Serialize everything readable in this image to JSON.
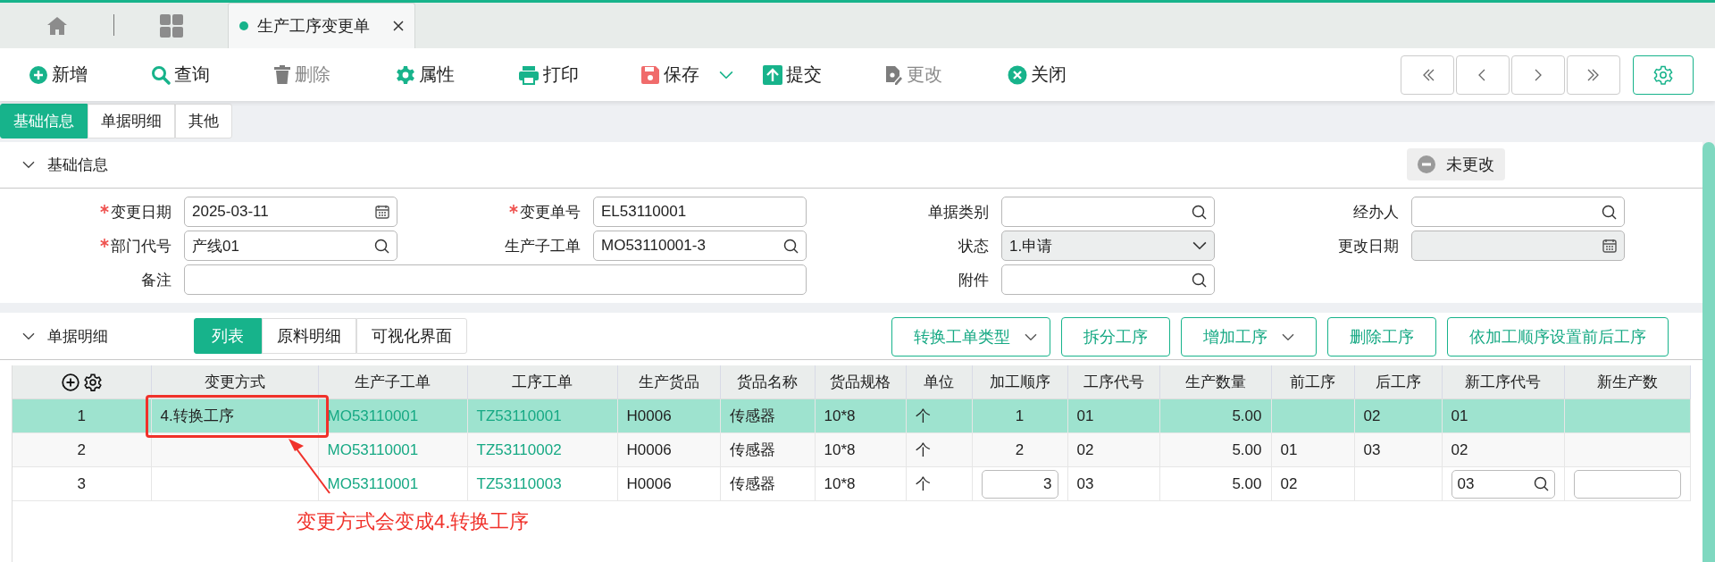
{
  "tabs": [
    {
      "label": "生产工序变更单",
      "selected": true
    }
  ],
  "toolbar": [
    {
      "kind": "add",
      "label": "新增",
      "disabled": false
    },
    {
      "kind": "query",
      "label": "查询",
      "disabled": false
    },
    {
      "kind": "delete",
      "label": "删除",
      "disabled": true
    },
    {
      "kind": "properties",
      "label": "属性",
      "disabled": false
    },
    {
      "kind": "print",
      "label": "打印",
      "disabled": false
    },
    {
      "kind": "save",
      "label": "保存",
      "disabled": false,
      "dropdown": true
    },
    {
      "kind": "submit",
      "label": "提交",
      "disabled": false
    },
    {
      "kind": "modify",
      "label": "更改",
      "disabled": true
    },
    {
      "kind": "close",
      "label": "关闭",
      "disabled": false
    }
  ],
  "page_tabs": [
    {
      "label": "基础信息",
      "selected": true
    },
    {
      "label": "单据明细",
      "selected": false
    },
    {
      "label": "其他",
      "selected": false
    }
  ],
  "basic_section": {
    "title": "基础信息",
    "expanded": true,
    "status_badge": "未更改",
    "rows": [
      [
        {
          "label": "变更日期",
          "required": true,
          "value": "2025-03-11",
          "kind": "date"
        },
        {
          "label": "变更单号",
          "required": true,
          "value": "EL53110001",
          "kind": "text"
        },
        {
          "label": "单据类别",
          "required": false,
          "kind": "lookup"
        },
        {
          "label": "经办人",
          "required": false,
          "kind": "lookup"
        }
      ],
      [
        {
          "label": "部门代号",
          "required": true,
          "value": "产线01",
          "kind": "lookup"
        },
        {
          "label": "生产子工单",
          "required": false,
          "value": "MO53110001-3",
          "kind": "lookup"
        },
        {
          "label": "状态",
          "required": false,
          "value": "1.申请",
          "kind": "select"
        },
        {
          "label": "更改日期",
          "required": false,
          "kind": "date",
          "disabled": true
        }
      ],
      [
        {
          "label": "备注",
          "required": false,
          "kind": "text",
          "wide": true
        },
        null,
        {
          "label": "附件",
          "required": false,
          "kind": "lookup"
        }
      ]
    ]
  },
  "detail_section": {
    "title": "单据明细",
    "expanded": true,
    "sub_tabs": [
      {
        "label": "列表",
        "selected": true
      },
      {
        "label": "原料明细",
        "selected": false
      },
      {
        "label": "可视化界面",
        "selected": false
      }
    ],
    "actions": [
      {
        "label": "转换工单类型",
        "dropdown": true
      },
      {
        "label": "拆分工序",
        "dropdown": false
      },
      {
        "label": "增加工序",
        "dropdown": true
      },
      {
        "label": "删除工序",
        "dropdown": false
      },
      {
        "label": "依加工顺序设置前后工序",
        "dropdown": false
      }
    ]
  },
  "table": {
    "columns": [
      {
        "kind": "index"
      },
      {
        "label": "变更方式",
        "kind": "text"
      },
      {
        "label": "生产子工单",
        "kind": "link"
      },
      {
        "label": "工序工单",
        "kind": "link"
      },
      {
        "label": "生产货品",
        "kind": "text"
      },
      {
        "label": "货品名称",
        "kind": "text"
      },
      {
        "label": "货品规格",
        "kind": "text"
      },
      {
        "label": "单位",
        "kind": "text"
      },
      {
        "label": "加工顺序",
        "kind": "order"
      },
      {
        "label": "工序代号",
        "kind": "text"
      },
      {
        "label": "生产数量",
        "kind": "number"
      },
      {
        "label": "前工序",
        "kind": "text"
      },
      {
        "label": "后工序",
        "kind": "text"
      },
      {
        "label": "新工序代号",
        "kind": "lookup"
      },
      {
        "label": "新生产数",
        "kind": "input"
      }
    ],
    "rows": [
      {
        "selected": true,
        "editing": false,
        "cells": [
          "1",
          "4.转换工序",
          "MO53110001",
          "TZ53110001",
          "H0006",
          "传感器",
          "10*8",
          "个",
          "1",
          "01",
          "5.00",
          null,
          "02",
          "01",
          null
        ]
      },
      {
        "selected": false,
        "editing": false,
        "cells": [
          "2",
          null,
          "MO53110001",
          "TZ53110002",
          "H0006",
          "传感器",
          "10*8",
          "个",
          "2",
          "02",
          "5.00",
          "01",
          "03",
          "02",
          null
        ]
      },
      {
        "selected": false,
        "editing": true,
        "cells": [
          "3",
          null,
          "MO53110001",
          "TZ53110003",
          "H0006",
          "传感器",
          "10*8",
          "个",
          "3",
          "03",
          "5.00",
          "02",
          null,
          "03",
          null
        ]
      }
    ]
  },
  "annotation": {
    "text": "变更方式会变成4.转换工序"
  }
}
